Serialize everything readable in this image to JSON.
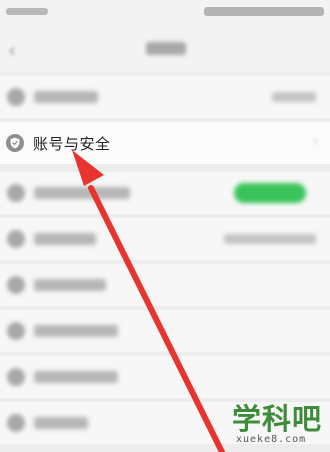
{
  "settings": {
    "account_security_label": "账号与安全"
  },
  "icons": {
    "account_security_icon": "shield-icon",
    "annotation": "red-arrow",
    "annotation_color": "#e8342e"
  },
  "watermark": {
    "name": "学科吧",
    "url": "xueke8.com",
    "color": "#3c8c3a"
  }
}
